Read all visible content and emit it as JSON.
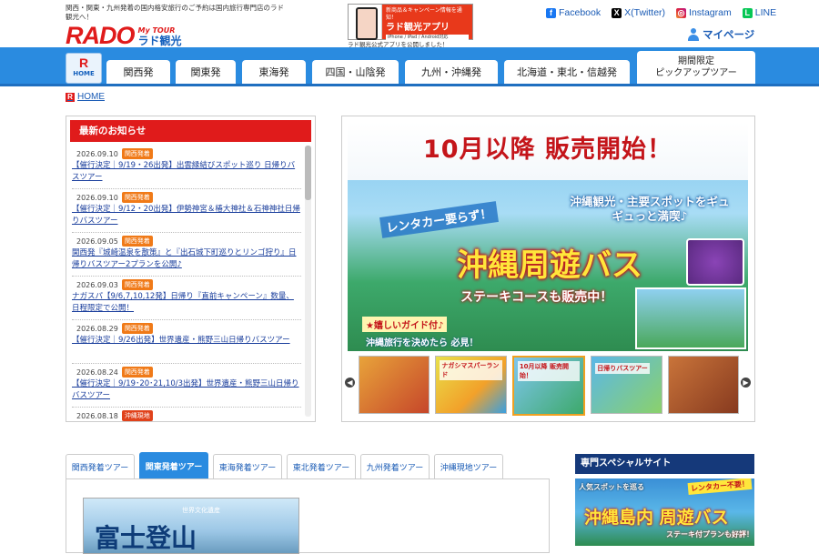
{
  "header": {
    "tagline": "関西・関東・九州発着の国内格安旅行のご予約は国内旅行専門店のラド観光へ！",
    "logo_text": "RADO",
    "logo_tour": "My TOUR",
    "logo_jp": "ラド観光",
    "app_banner": {
      "line1": "新商品＆キャンペーン情報を通知！",
      "title": "ラド観光アプリ",
      "devices": "iPhone / iPad / Android対応"
    },
    "app_caption": "ラド観光公式アプリを公開しました！",
    "social": [
      {
        "label": "Facebook",
        "icon": "facebook-icon",
        "glyph": "f"
      },
      {
        "label": "X(Twitter)",
        "icon": "x-icon",
        "glyph": "X"
      },
      {
        "label": "Instagram",
        "icon": "instagram-icon",
        "glyph": "◎"
      },
      {
        "label": "LINE",
        "icon": "line-icon",
        "glyph": "L"
      }
    ],
    "mypage": "マイページ"
  },
  "nav": {
    "home_r": "R",
    "home_label": "HOME",
    "tabs": [
      "関西発",
      "関東発",
      "東海発",
      "四国・山陰発",
      "九州・沖縄発",
      "北海道・東北・信越発"
    ],
    "pickup_line1": "期間限定",
    "pickup_line2": "ピックアップツアー"
  },
  "breadcrumb": {
    "home": "HOME"
  },
  "news": {
    "title": "最新のお知らせ",
    "items": [
      {
        "date": "2026.09.10",
        "badge": "関西発着",
        "title": "【催行決定｜9/19・26出発】出雲縁結びスポット巡り 日帰りバスツアー"
      },
      {
        "date": "2026.09.10",
        "badge": "関西発着",
        "title": "【催行決定｜9/12・20出発】伊勢神宮＆椿大神社＆石神神社日帰りバスツアー"
      },
      {
        "date": "2026.09.05",
        "badge": "関西発着",
        "title": "関西発『城崎温泉を散策』と『出石城下町巡りとリンゴ狩り』日帰りバスツアー2プランを公開♪"
      },
      {
        "date": "2026.09.03",
        "badge": "関西発着",
        "title": "ナガスパ【9/6,7,10,12発】日帰り『直前キャンペーン』数量、日程限定で公開！"
      },
      {
        "date": "2026.08.29",
        "badge": "関西発着",
        "title": "【催行決定｜9/26出発】世界遺産・熊野三山日帰りバスツアー"
      },
      {
        "date": "2026.08.24",
        "badge": "関西発着",
        "title": "【催行決定｜9/19･20･21,10/3出発】世界遺産・熊野三山日帰りバスツアー"
      },
      {
        "date": "2026.08.18",
        "badge": "沖縄現地",
        "title": ""
      }
    ]
  },
  "hero": {
    "title": "10月以降 販売開始！",
    "rent": "レンタカー要らず！",
    "sub": "沖縄観光・主要スポットをギュギュっと満喫♪",
    "main": "沖縄周遊バス",
    "steak": "ステーキコースも販売中！",
    "guide": "★嬉しいガイド付♪",
    "decide": "沖縄旅行を決めたら 必見！",
    "thumb_labels": [
      "",
      "ナガシマスパーランド",
      "10月以降 販売開始！",
      "日帰りバスツアー",
      ""
    ]
  },
  "tour_tabs": {
    "items": [
      "関西発着ツアー",
      "関東発着ツアー",
      "東海発着ツアー",
      "東北発着ツアー",
      "九州発着ツアー",
      "沖縄現地ツアー"
    ],
    "active": 1,
    "panel_title": "富士登山",
    "panel_sub": "世界文化遺産"
  },
  "special": {
    "title": "専門スペシャルサイト",
    "banner_line1": "人気スポットを巡る",
    "banner_badge": "レンタカー不要！",
    "banner_main": "沖縄島内 周遊バス",
    "banner_sub": "ステーキ付プランも好評！"
  },
  "colors": {
    "brand_red": "#e01b1b",
    "nav_blue": "#2a8be0",
    "badge_orange": "#f07a18",
    "link_blue": "#1a5bb5"
  }
}
